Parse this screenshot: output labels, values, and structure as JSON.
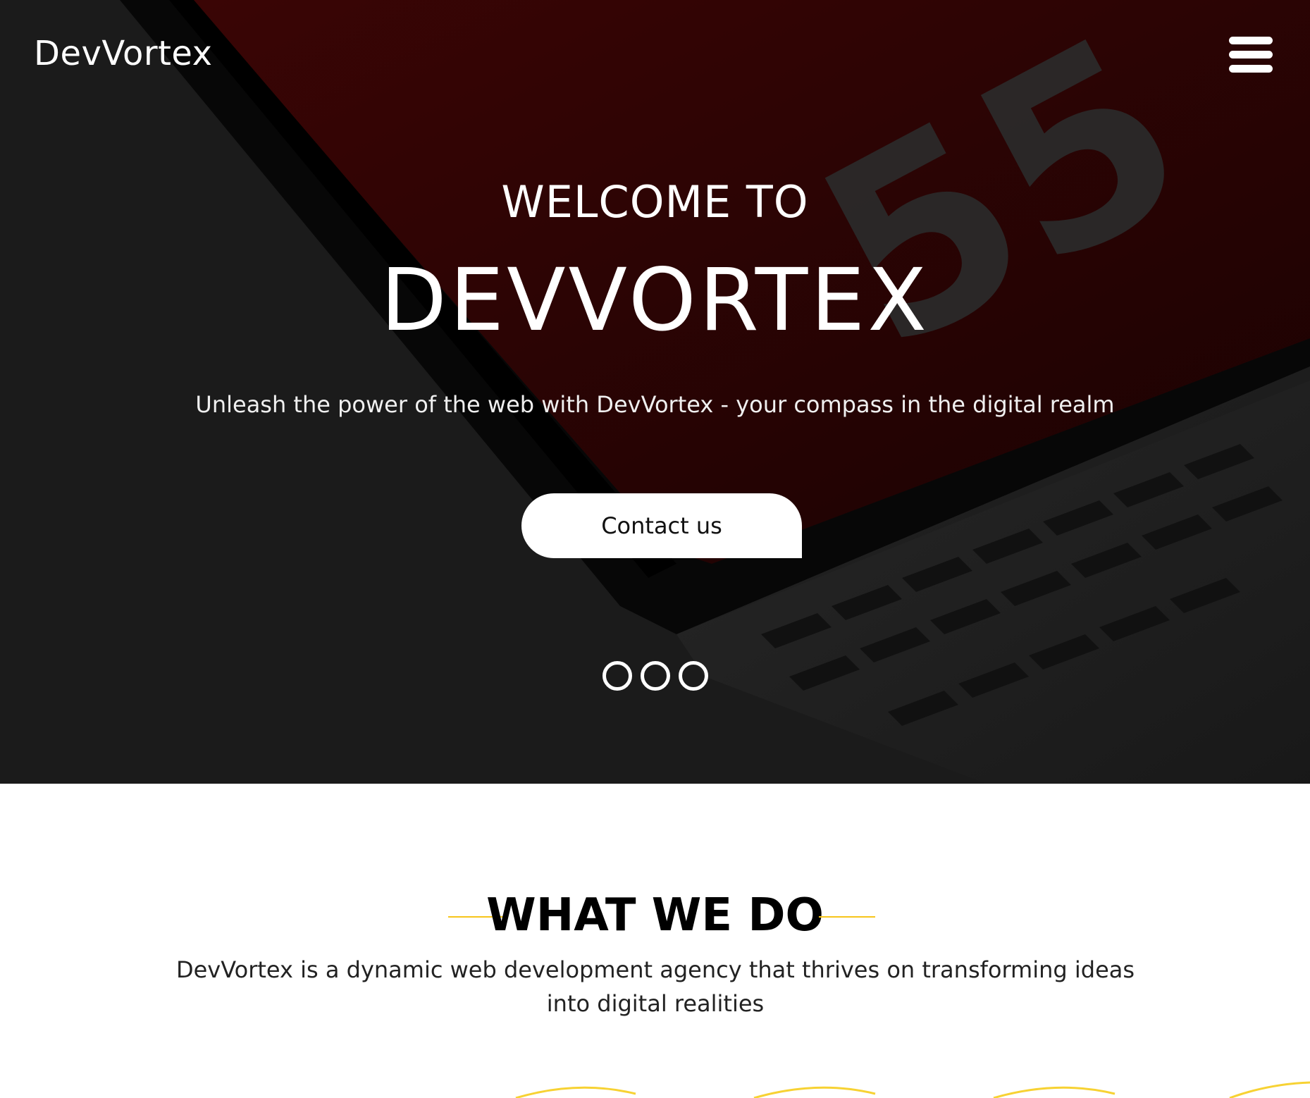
{
  "navbar": {
    "brand": "DevVortex",
    "menu_icon": "hamburger-menu-icon"
  },
  "hero": {
    "welcome": "WELCOME TO",
    "headline": "DEVVORTEX",
    "tagline": "Unleash the power of the web with DevVortex - your compass in the digital realm",
    "cta_label": "Contact us",
    "background_number": "55",
    "slide_count": 3
  },
  "what_we_do": {
    "heading": "WHAT WE DO",
    "description": "DevVortex is a dynamic web development agency that thrives on transforming ideas into digital realities",
    "accent_color": "#f7c51b"
  },
  "colors": {
    "hero_bg": "#1b1b1b",
    "hero_accent_red": "#2a0505",
    "text_light": "#ffffff",
    "accent_yellow": "#f7c51b"
  }
}
